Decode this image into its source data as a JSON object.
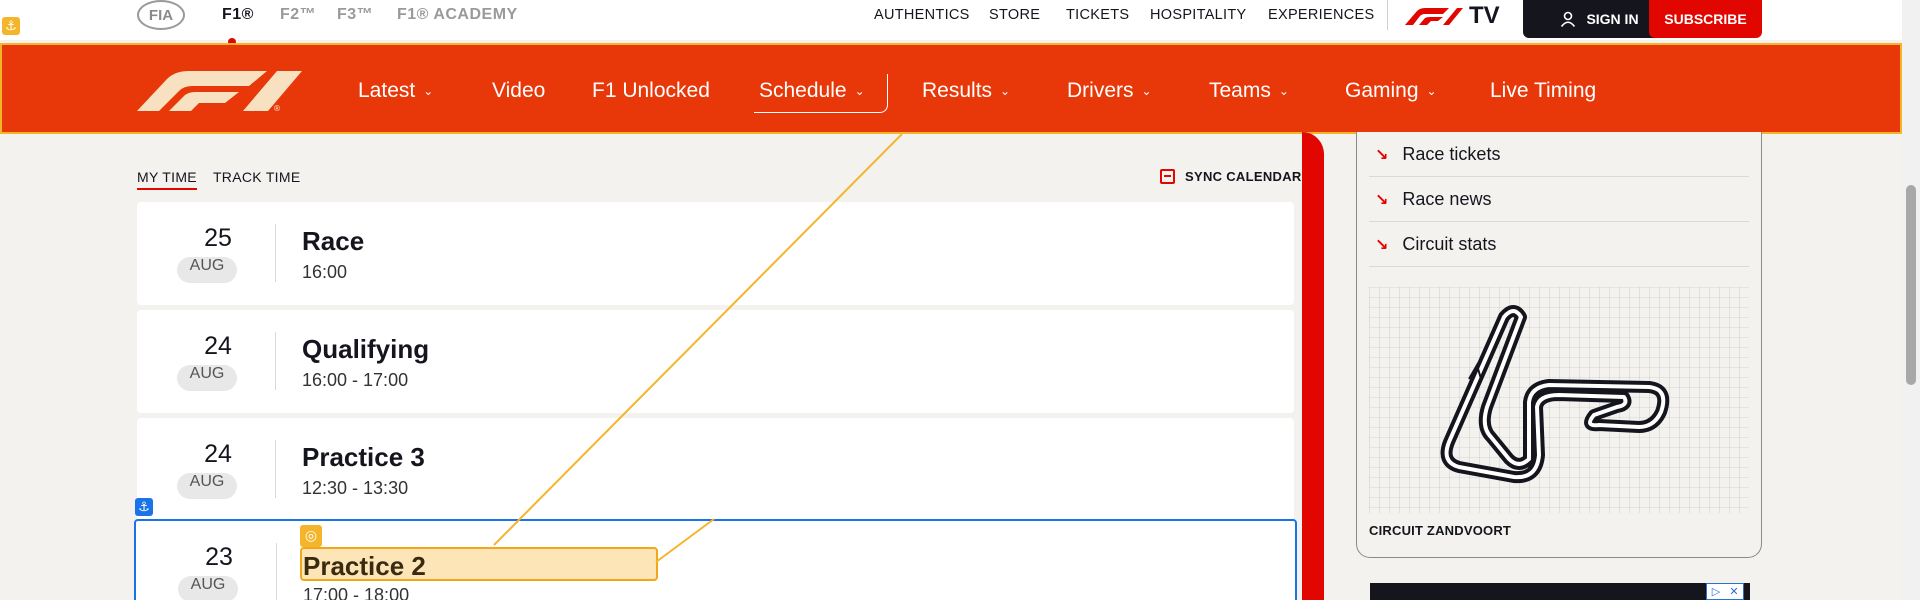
{
  "topbar": {
    "fia": "FIA",
    "series": [
      {
        "label": "F1®",
        "active": true
      },
      {
        "label": "F2™",
        "active": false
      },
      {
        "label": "F3™",
        "active": false
      },
      {
        "label": "F1® ACADEMY",
        "active": false
      }
    ],
    "links": [
      "AUTHENTICS",
      "STORE",
      "TICKETS",
      "HOSPITALITY",
      "EXPERIENCES"
    ],
    "tv_label": "TV",
    "sign_in": "SIGN IN",
    "subscribe": "SUBSCRIBE"
  },
  "nav": {
    "items": [
      {
        "label": "Latest",
        "dropdown": true
      },
      {
        "label": "Video",
        "dropdown": false
      },
      {
        "label": "F1 Unlocked",
        "dropdown": false
      },
      {
        "label": "Schedule",
        "dropdown": true
      },
      {
        "label": "Results",
        "dropdown": true
      },
      {
        "label": "Drivers",
        "dropdown": true
      },
      {
        "label": "Teams",
        "dropdown": true
      },
      {
        "label": "Gaming",
        "dropdown": true
      },
      {
        "label": "Live Timing",
        "dropdown": false
      }
    ]
  },
  "schedule": {
    "tabs": [
      {
        "label": "MY TIME",
        "active": true
      },
      {
        "label": "TRACK TIME",
        "active": false
      }
    ],
    "sync_label": "SYNC CALENDAR",
    "sessions": [
      {
        "day": "25",
        "month": "AUG",
        "name": "Race",
        "time": "16:00"
      },
      {
        "day": "24",
        "month": "AUG",
        "name": "Qualifying",
        "time": "16:00 - 17:00"
      },
      {
        "day": "24",
        "month": "AUG",
        "name": "Practice 3",
        "time": "12:30 - 13:30"
      },
      {
        "day": "23",
        "month": "AUG",
        "name": "Practice 2",
        "time": "17:00 - 18:00"
      }
    ]
  },
  "sidebar": {
    "links": [
      "Race tickets",
      "Race news",
      "Circuit stats"
    ],
    "circuit_name": "CIRCUIT ZANDVOORT"
  },
  "colors": {
    "nav_bg": "#e8380a",
    "accent_red": "#e10600",
    "highlight_orange": "#f4b52b",
    "highlight_blue": "#1a73e8"
  }
}
